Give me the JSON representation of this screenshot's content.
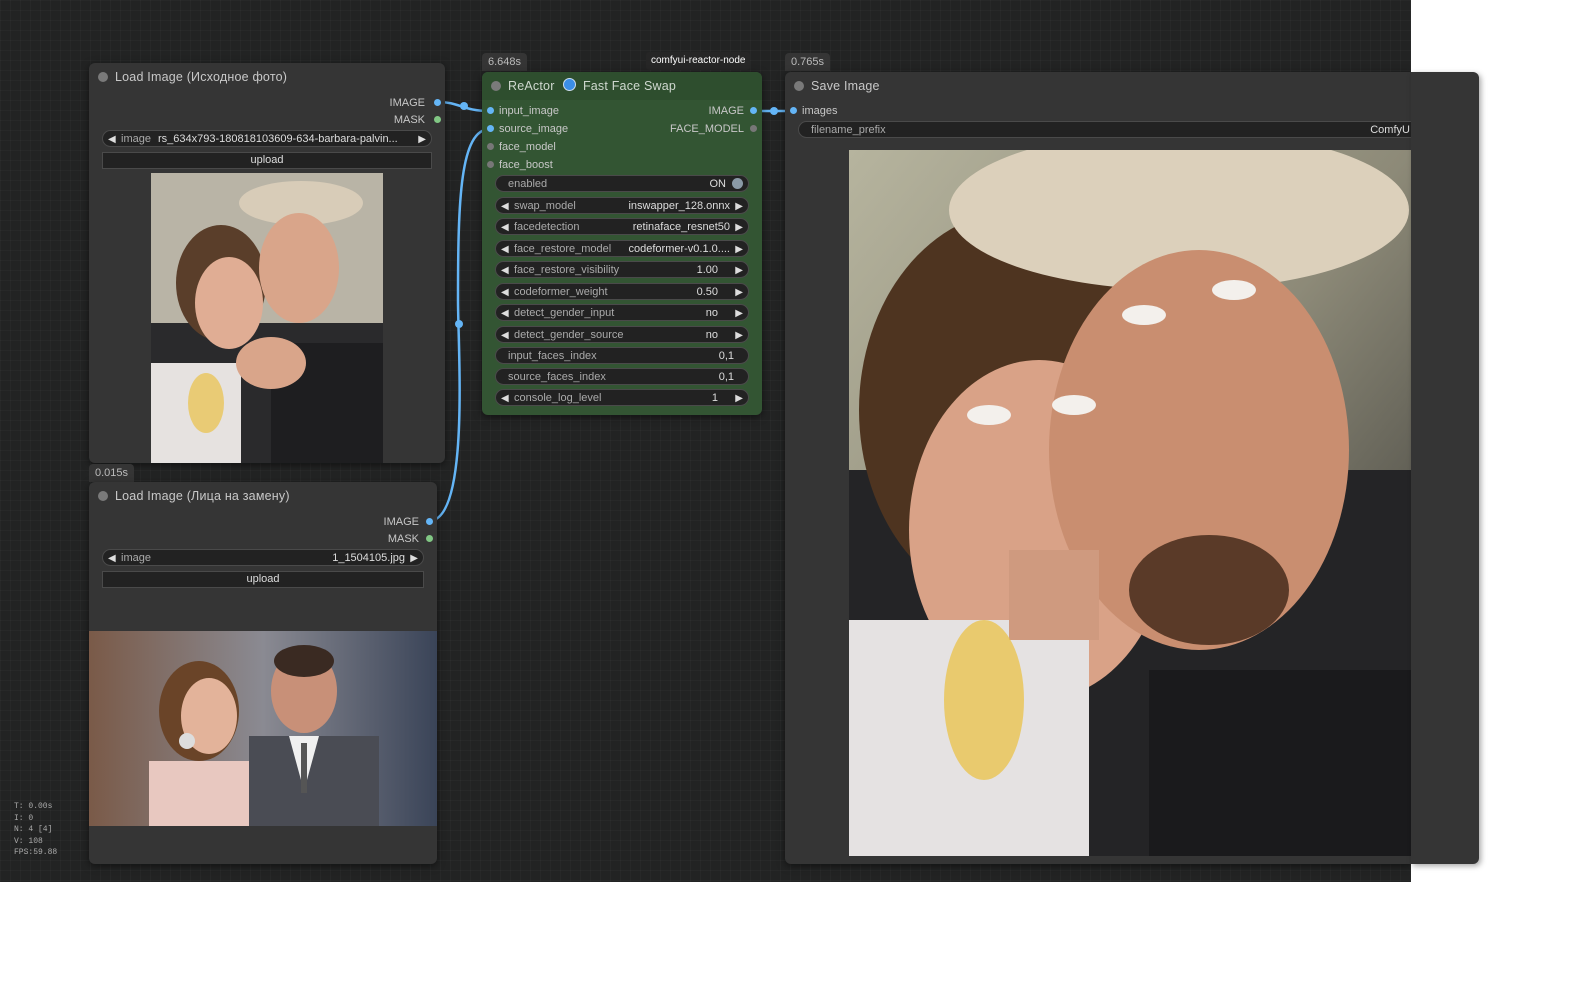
{
  "nodes": {
    "load1": {
      "title": "Load Image (Исходное фото)",
      "out_image": "IMAGE",
      "out_mask": "MASK",
      "image_label": "image",
      "image_value": "rs_634x793-180818103609-634-barbara-palvin...",
      "upload": "upload"
    },
    "load2": {
      "time": "0.015s",
      "title": "Load Image (Лица на замену)",
      "out_image": "IMAGE",
      "out_mask": "MASK",
      "image_label": "image",
      "image_value": "1_1504105.jpg",
      "upload": "upload"
    },
    "reactor": {
      "time": "6.648s",
      "badge": "comfyui-reactor-node",
      "title_a": "ReActor",
      "title_b": "Fast Face Swap",
      "inputs": [
        "input_image",
        "source_image",
        "face_model",
        "face_boost"
      ],
      "out_image": "IMAGE",
      "out_face_model": "FACE_MODEL",
      "widgets": [
        {
          "label": "enabled",
          "value": "ON"
        },
        {
          "label": "swap_model",
          "value": "inswapper_128.onnx"
        },
        {
          "label": "facedetection",
          "value": "retinaface_resnet50"
        },
        {
          "label": "face_restore_model",
          "value": "codeformer-v0.1.0...."
        },
        {
          "label": "face_restore_visibility",
          "value": "1.00"
        },
        {
          "label": "codeformer_weight",
          "value": "0.50"
        },
        {
          "label": "detect_gender_input",
          "value": "no"
        },
        {
          "label": "detect_gender_source",
          "value": "no"
        },
        {
          "label": "input_faces_index",
          "value": "0,1"
        },
        {
          "label": "source_faces_index",
          "value": "0,1"
        },
        {
          "label": "console_log_level",
          "value": "1"
        }
      ]
    },
    "save": {
      "time": "0.765s",
      "title": "Save Image",
      "in_images": "images",
      "prefix_label": "filename_prefix",
      "prefix_value": "ComfyUI"
    }
  },
  "stats": [
    "T: 0.00s",
    "I: 0",
    "N: 4 [4]",
    "V: 108",
    "FPS:59.88"
  ],
  "colors": {
    "canvas": "#222323",
    "node": "#353535",
    "reactor_node": "#335533",
    "link_image": "#64b5f6",
    "mask_slot": "#81c784"
  }
}
